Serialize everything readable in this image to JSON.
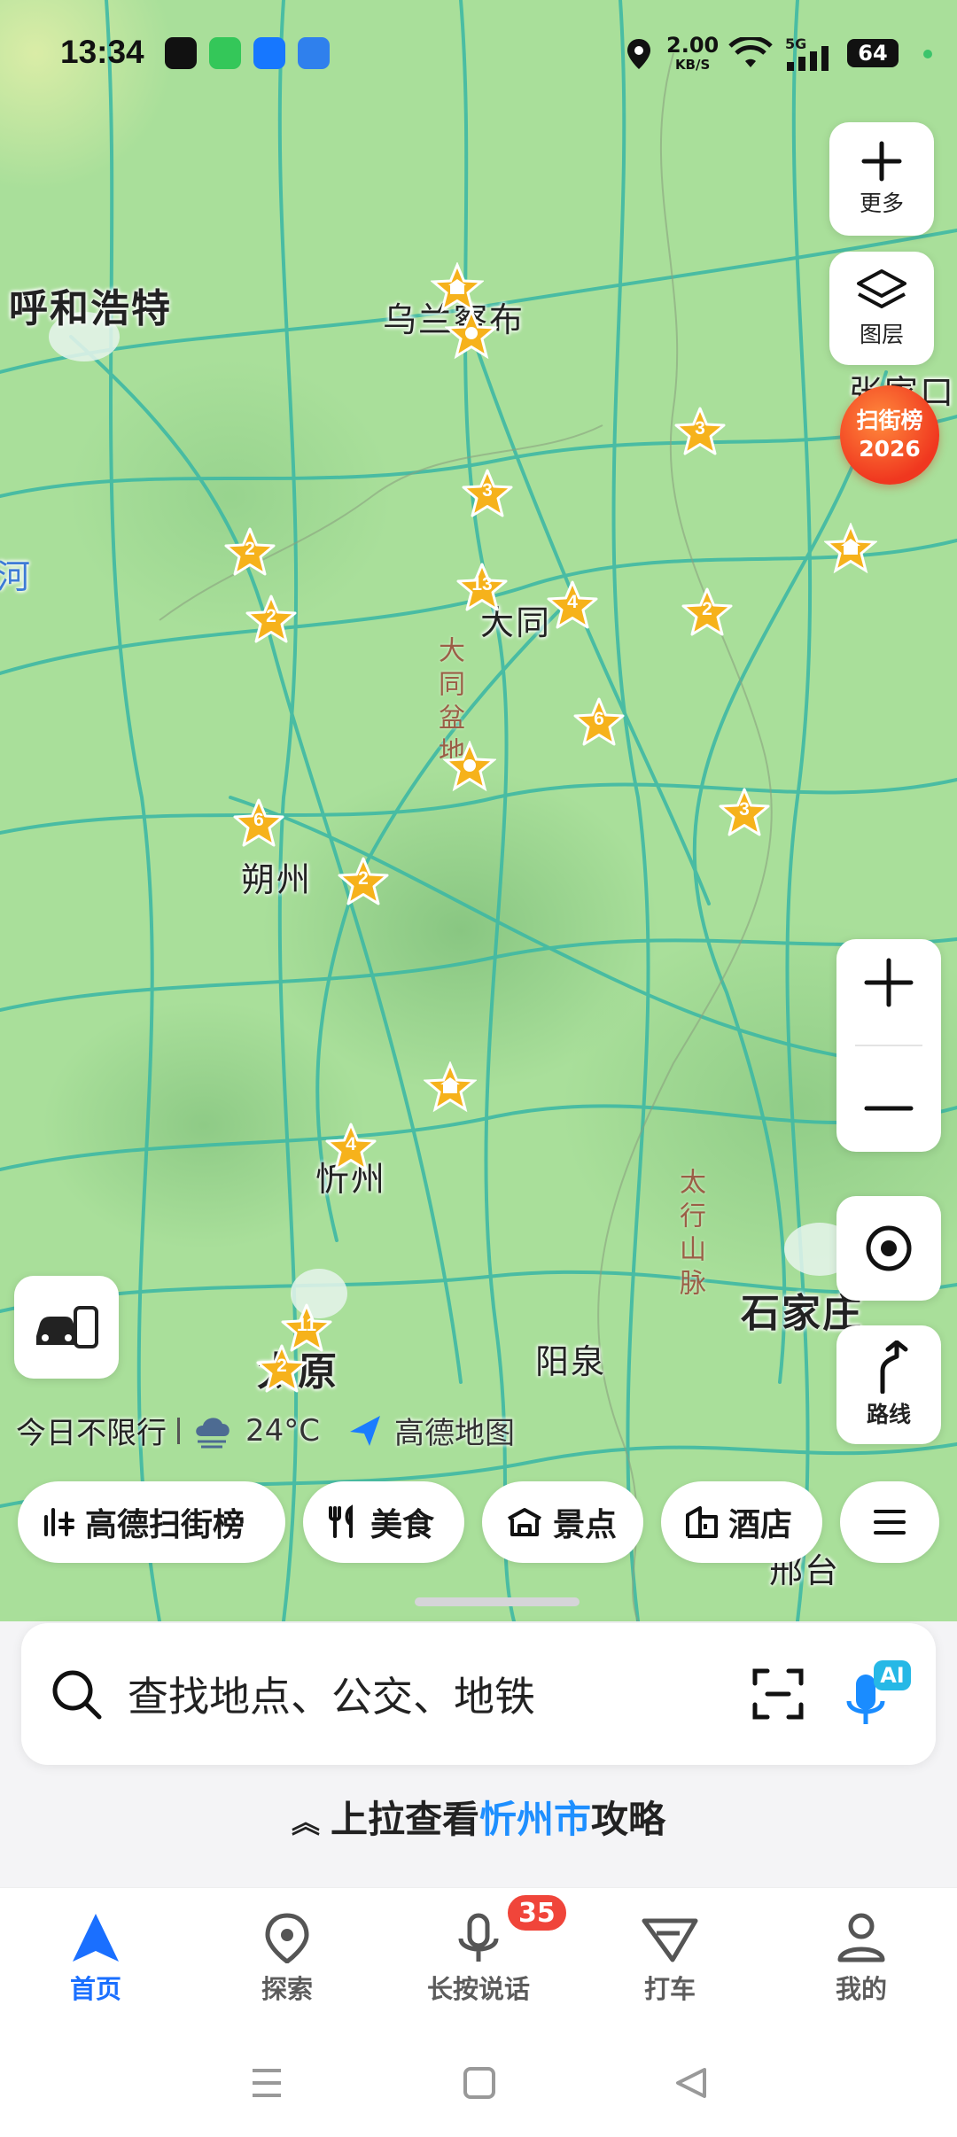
{
  "status_bar": {
    "time": "13:34",
    "speed_value": "2.00",
    "speed_unit": "KB/S",
    "network": "5G",
    "battery": "64"
  },
  "map": {
    "cities": [
      {
        "key": "huhehaote",
        "label": "呼和浩特"
      },
      {
        "key": "wulanchabu",
        "label": "乌兰察布"
      },
      {
        "key": "zhangjiakou",
        "label": "张家口"
      },
      {
        "key": "datong",
        "label": "大同"
      },
      {
        "key": "shuozhou",
        "label": "朔州"
      },
      {
        "key": "xinzhou",
        "label": "忻州"
      },
      {
        "key": "taiyuan",
        "label": "太原"
      },
      {
        "key": "yangquan",
        "label": "阳泉"
      },
      {
        "key": "shijiazhuang",
        "label": "石家庄"
      },
      {
        "key": "xingtai",
        "label": "邢台"
      },
      {
        "key": "he",
        "label": "河"
      }
    ],
    "terrain": [
      {
        "key": "datong_basin",
        "label": "大同盆地"
      },
      {
        "key": "taihang",
        "label": "太行山脉"
      }
    ],
    "markers": [
      {
        "key": "m1",
        "label": "3"
      },
      {
        "key": "m2",
        "label": "3"
      },
      {
        "key": "m3",
        "label": "2"
      },
      {
        "key": "m4",
        "label": "2"
      },
      {
        "key": "m5",
        "label": "13"
      },
      {
        "key": "m6",
        "label": "4"
      },
      {
        "key": "m7",
        "label": "2"
      },
      {
        "key": "m8",
        "label": "6"
      },
      {
        "key": "m9",
        "label": "6"
      },
      {
        "key": "m10",
        "label": "2"
      },
      {
        "key": "m11",
        "label": "3"
      },
      {
        "key": "m12",
        "label": "4"
      },
      {
        "key": "m13",
        "label": "11"
      },
      {
        "key": "m14",
        "label": "2"
      }
    ]
  },
  "controls": {
    "more_label": "更多",
    "layers_label": "图层",
    "route_label": "路线",
    "rank_badge_line1": "扫街榜",
    "rank_badge_line2": "2026"
  },
  "info": {
    "restriction": "今日不限行",
    "temperature": "24°C",
    "brand": "高德地图"
  },
  "chips": [
    {
      "label": "高德扫街榜"
    },
    {
      "label": "美食"
    },
    {
      "label": "景点"
    },
    {
      "label": "酒店"
    }
  ],
  "search": {
    "placeholder": "查找地点、公交、地铁",
    "ai_label": "AI"
  },
  "pullup": {
    "prefix": "上拉查看",
    "city": "忻州市",
    "suffix": "攻略"
  },
  "nav": {
    "items": [
      {
        "label": "首页"
      },
      {
        "label": "探索"
      },
      {
        "label": "长按说话"
      },
      {
        "label": "打车"
      },
      {
        "label": "我的"
      }
    ],
    "badge": "35"
  }
}
